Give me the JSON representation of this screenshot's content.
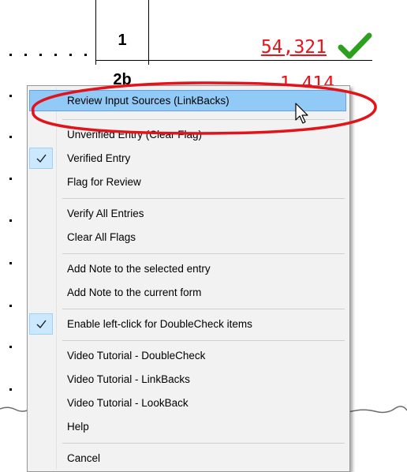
{
  "form": {
    "line_number": "1",
    "line_number_next_partial": "2b",
    "amount": "54,321",
    "amount_next_partial": "1,414",
    "status_icon": "green-checkmark-icon"
  },
  "context_menu": {
    "items": [
      {
        "label": "Review Input Sources (LinkBacks)",
        "highlighted": true,
        "checked": false
      },
      {
        "label": "Unverified Entry (Clear Flag)",
        "checked": false
      },
      {
        "label": "Verified Entry",
        "checked": true
      },
      {
        "label": "Flag for Review",
        "checked": false
      },
      {
        "label": "Verify All Entries",
        "checked": false
      },
      {
        "label": "Clear All Flags",
        "checked": false
      },
      {
        "label": "Add Note to the selected entry",
        "checked": false
      },
      {
        "label": "Add Note to the current form",
        "checked": false
      },
      {
        "label": "Enable left-click for DoubleCheck items",
        "checked": true
      },
      {
        "label": "Video Tutorial - DoubleCheck",
        "checked": false
      },
      {
        "label": "Video Tutorial - LinkBacks",
        "checked": false
      },
      {
        "label": "Video Tutorial - LookBack",
        "checked": false
      },
      {
        "label": "Help",
        "checked": false
      },
      {
        "label": "Cancel",
        "checked": false
      }
    ]
  },
  "colors": {
    "amount_text": "#e8141a",
    "annotation_ellipse": "#e0141a",
    "highlight_fill": "#91c9f7",
    "checkmark": "#2da01e"
  }
}
